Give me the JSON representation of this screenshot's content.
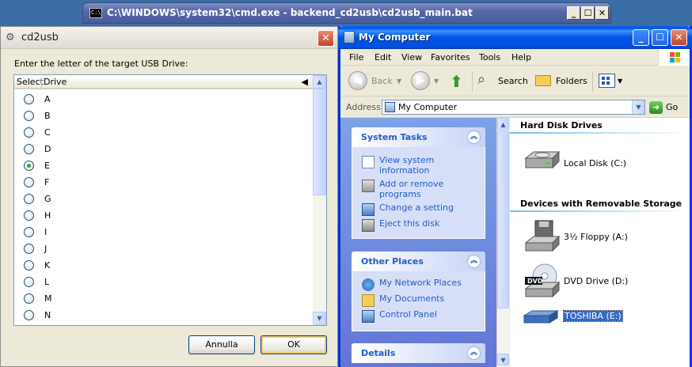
{
  "cmd": {
    "title": "C:\\WINDOWS\\system32\\cmd.exe - backend_cd2usb\\cd2usb_main.bat",
    "icon": "C:\\"
  },
  "dialog": {
    "title": "cd2usb",
    "prompt": "Enter the letter of the target USB Drive:",
    "columns": [
      "Select",
      "Drive"
    ],
    "drives": [
      "A",
      "B",
      "C",
      "D",
      "E",
      "F",
      "G",
      "H",
      "I",
      "J",
      "K",
      "L",
      "M",
      "N"
    ],
    "selected": "E",
    "cancel_label": "Annulla",
    "ok_label": "OK"
  },
  "explorer": {
    "title": "My Computer",
    "menu": [
      "File",
      "Edit",
      "View",
      "Favorites",
      "Tools",
      "Help"
    ],
    "toolbar": {
      "back": "Back",
      "search": "Search",
      "folders": "Folders"
    },
    "address": {
      "label": "Address",
      "value": "My Computer",
      "go": "Go"
    },
    "system_tasks": {
      "title": "System Tasks",
      "items": [
        "View system information",
        "Add or remove programs",
        "Change a setting",
        "Eject this disk"
      ]
    },
    "other_places": {
      "title": "Other Places",
      "items": [
        "My Network Places",
        "My Documents",
        "Control Panel"
      ]
    },
    "details": {
      "title": "Details"
    },
    "hard_disks": {
      "title": "Hard Disk Drives",
      "items": [
        "Local Disk (C:)"
      ]
    },
    "removable": {
      "title": "Devices with Removable Storage",
      "items": [
        "3½ Floppy (A:)",
        "DVD Drive (D:)",
        "TOSHIBA (E:)"
      ],
      "dvd_badge": "DVD"
    }
  },
  "colors": {
    "xp_blue": "#0831d9",
    "link_blue": "#215dc6",
    "selection": "#316ac5"
  }
}
